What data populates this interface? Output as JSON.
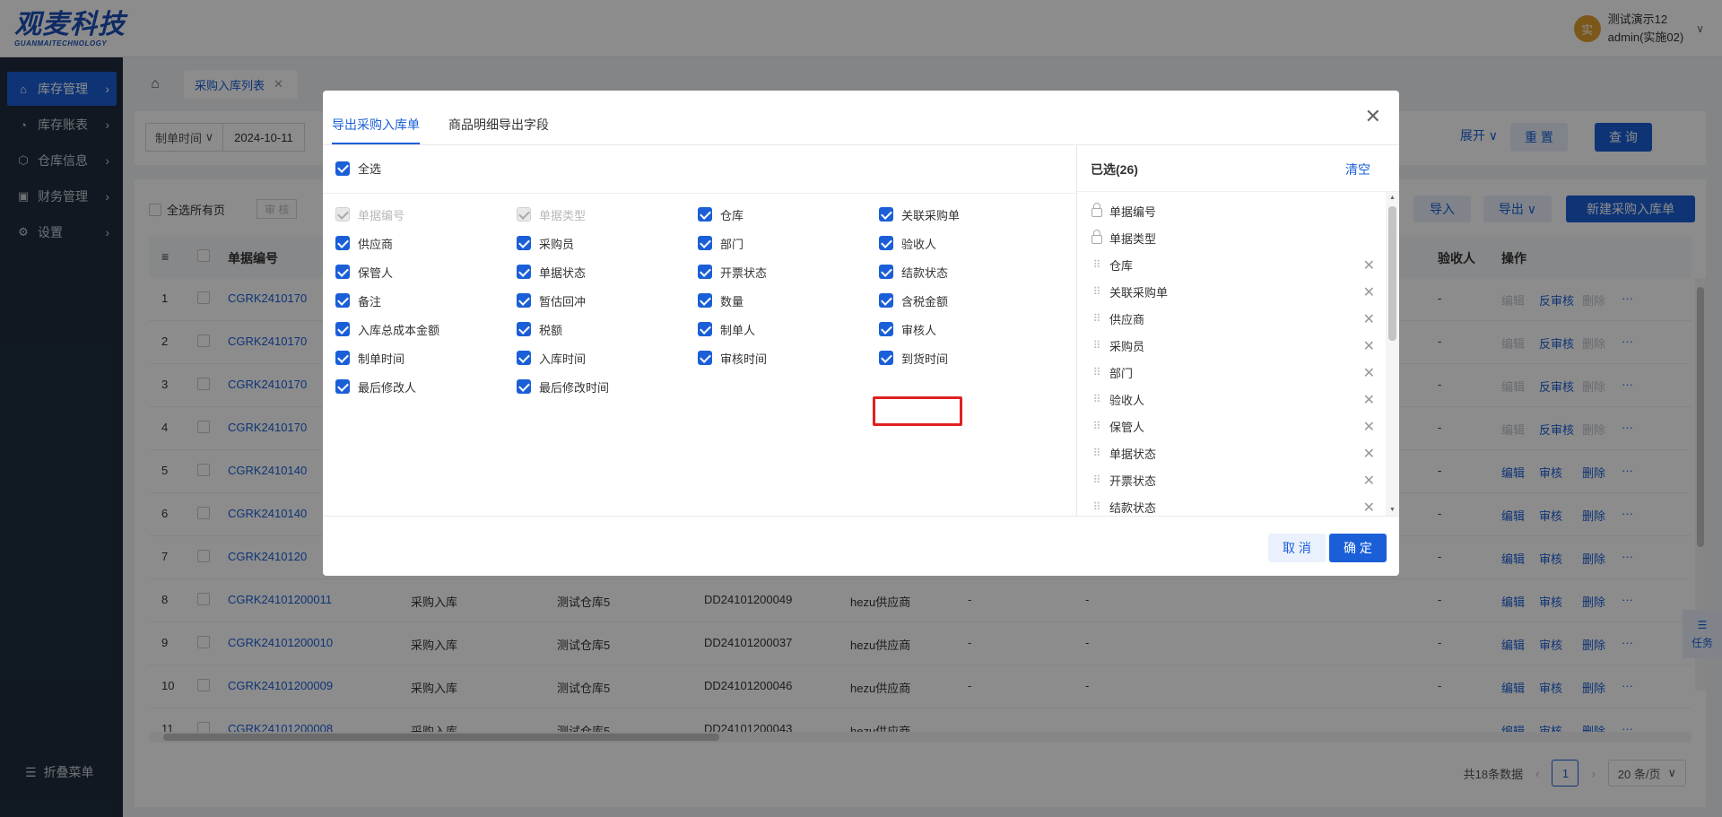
{
  "brand": {
    "name_cn": "观麦科技",
    "name_en": "GUANMAITECHNOLOGY"
  },
  "user": {
    "avatar": "实",
    "line1": "测试演示12",
    "line2": "admin(实施02)"
  },
  "sidebar": {
    "items": [
      {
        "label": "库存管理",
        "icon": "warehouse-icon"
      },
      {
        "label": "库存账表",
        "icon": "chart-icon"
      },
      {
        "label": "仓库信息",
        "icon": "box-icon"
      },
      {
        "label": "财务管理",
        "icon": "finance-icon"
      },
      {
        "label": "设置",
        "icon": "gear-icon"
      }
    ],
    "collapse_label": "折叠菜单"
  },
  "tabs": {
    "current": "采购入库列表"
  },
  "filter": {
    "date_label": "制单时间",
    "date_value": "2024-10-11",
    "expand": "展开",
    "reset": "重 置",
    "query": "查 询"
  },
  "toolbar": {
    "select_all_pages": "全选所有页",
    "audit": "审 核",
    "import": "导入",
    "export": "导出",
    "new": "新建采购入库单"
  },
  "table": {
    "headers": {
      "no": "单据编号",
      "receiver": "验收人",
      "ops": "操作"
    },
    "rows": [
      {
        "idx": "1",
        "no": "CGRK2410170",
        "type": "",
        "warehouse": "",
        "order": "",
        "supplier": "",
        "a": "",
        "b": "",
        "c": "-",
        "ops": [
          "编辑",
          "反审核",
          "删除"
        ],
        "ops_state": [
          false,
          true,
          false
        ]
      },
      {
        "idx": "2",
        "no": "CGRK2410170",
        "type": "",
        "warehouse": "",
        "order": "",
        "supplier": "",
        "a": "",
        "b": "",
        "c": "-",
        "ops": [
          "编辑",
          "反审核",
          "删除"
        ],
        "ops_state": [
          false,
          true,
          false
        ]
      },
      {
        "idx": "3",
        "no": "CGRK2410170",
        "type": "",
        "warehouse": "",
        "order": "",
        "supplier": "",
        "a": "",
        "b": "",
        "c": "-",
        "ops": [
          "编辑",
          "反审核",
          "删除"
        ],
        "ops_state": [
          false,
          true,
          false
        ]
      },
      {
        "idx": "4",
        "no": "CGRK2410170",
        "type": "",
        "warehouse": "",
        "order": "",
        "supplier": "",
        "a": "",
        "b": "",
        "c": "-",
        "ops": [
          "编辑",
          "反审核",
          "删除"
        ],
        "ops_state": [
          false,
          true,
          false
        ]
      },
      {
        "idx": "5",
        "no": "CGRK2410140",
        "type": "",
        "warehouse": "",
        "order": "",
        "supplier": "",
        "a": "",
        "b": "",
        "c": "-",
        "ops": [
          "编辑",
          "审核",
          "删除"
        ],
        "ops_state": [
          true,
          true,
          true
        ]
      },
      {
        "idx": "6",
        "no": "CGRK2410140",
        "type": "",
        "warehouse": "",
        "order": "",
        "supplier": "",
        "a": "",
        "b": "",
        "c": "-",
        "ops": [
          "编辑",
          "审核",
          "删除"
        ],
        "ops_state": [
          true,
          true,
          true
        ]
      },
      {
        "idx": "7",
        "no": "CGRK2410120",
        "type": "",
        "warehouse": "",
        "order": "",
        "supplier": "",
        "a": "",
        "b": "",
        "c": "-",
        "ops": [
          "编辑",
          "审核",
          "删除"
        ],
        "ops_state": [
          true,
          true,
          true
        ]
      },
      {
        "idx": "8",
        "no": "CGRK24101200011",
        "type": "采购入库",
        "warehouse": "测试仓库5",
        "order": "DD24101200049",
        "supplier": "hezu供应商",
        "a": "-",
        "b": "-",
        "c": "-",
        "ops": [
          "编辑",
          "审核",
          "删除"
        ],
        "ops_state": [
          true,
          true,
          true
        ]
      },
      {
        "idx": "9",
        "no": "CGRK24101200010",
        "type": "采购入库",
        "warehouse": "测试仓库5",
        "order": "DD24101200037",
        "supplier": "hezu供应商",
        "a": "-",
        "b": "-",
        "c": "-",
        "ops": [
          "编辑",
          "审核",
          "删除"
        ],
        "ops_state": [
          true,
          true,
          true
        ]
      },
      {
        "idx": "10",
        "no": "CGRK24101200009",
        "type": "采购入库",
        "warehouse": "测试仓库5",
        "order": "DD24101200046",
        "supplier": "hezu供应商",
        "a": "-",
        "b": "-",
        "c": "-",
        "ops": [
          "编辑",
          "审核",
          "删除"
        ],
        "ops_state": [
          true,
          true,
          true
        ]
      },
      {
        "idx": "11",
        "no": "CGRK24101200008",
        "type": "采购入库",
        "warehouse": "测试仓库5",
        "order": "DD24101200043",
        "supplier": "hezu供应商",
        "a": "",
        "b": "",
        "c": "",
        "ops": [
          "编辑",
          "审核",
          "删除"
        ],
        "ops_state": [
          true,
          true,
          true
        ]
      }
    ],
    "more": "···"
  },
  "pager": {
    "total": "共18条数据",
    "page": "1",
    "size": "20 条/页"
  },
  "task_float": "任务",
  "modal": {
    "tabs": [
      "导出采购入库单",
      "商品明细导出字段"
    ],
    "select_all": "全选",
    "fields": [
      {
        "label": "单据编号",
        "disabled": true
      },
      {
        "label": "单据类型",
        "disabled": true
      },
      {
        "label": "仓库",
        "disabled": false
      },
      {
        "label": "关联采购单",
        "disabled": false
      },
      {
        "label": "供应商",
        "disabled": false
      },
      {
        "label": "采购员",
        "disabled": false
      },
      {
        "label": "部门",
        "disabled": false
      },
      {
        "label": "验收人",
        "disabled": false
      },
      {
        "label": "保管人",
        "disabled": false
      },
      {
        "label": "单据状态",
        "disabled": false
      },
      {
        "label": "开票状态",
        "disabled": false
      },
      {
        "label": "结款状态",
        "disabled": false
      },
      {
        "label": "备注",
        "disabled": false
      },
      {
        "label": "暂估回冲",
        "disabled": false
      },
      {
        "label": "数量",
        "disabled": false
      },
      {
        "label": "含税金额",
        "disabled": false
      },
      {
        "label": "入库总成本金额",
        "disabled": false
      },
      {
        "label": "税额",
        "disabled": false
      },
      {
        "label": "制单人",
        "disabled": false
      },
      {
        "label": "审核人",
        "disabled": false
      },
      {
        "label": "制单时间",
        "disabled": false
      },
      {
        "label": "入库时间",
        "disabled": false
      },
      {
        "label": "审核时间",
        "disabled": false
      },
      {
        "label": "到货时间",
        "disabled": false
      },
      {
        "label": "最后修改人",
        "disabled": false
      },
      {
        "label": "最后修改时间",
        "disabled": false
      }
    ],
    "selected_title": "已选(26)",
    "clear": "清空",
    "selected": [
      {
        "label": "单据编号",
        "locked": true
      },
      {
        "label": "单据类型",
        "locked": true
      },
      {
        "label": "仓库",
        "locked": false
      },
      {
        "label": "关联采购单",
        "locked": false
      },
      {
        "label": "供应商",
        "locked": false
      },
      {
        "label": "采购员",
        "locked": false
      },
      {
        "label": "部门",
        "locked": false
      },
      {
        "label": "验收人",
        "locked": false
      },
      {
        "label": "保管人",
        "locked": false
      },
      {
        "label": "单据状态",
        "locked": false
      },
      {
        "label": "开票状态",
        "locked": false
      },
      {
        "label": "结款状态",
        "locked": false
      }
    ],
    "cancel": "取 消",
    "ok": "确 定"
  }
}
